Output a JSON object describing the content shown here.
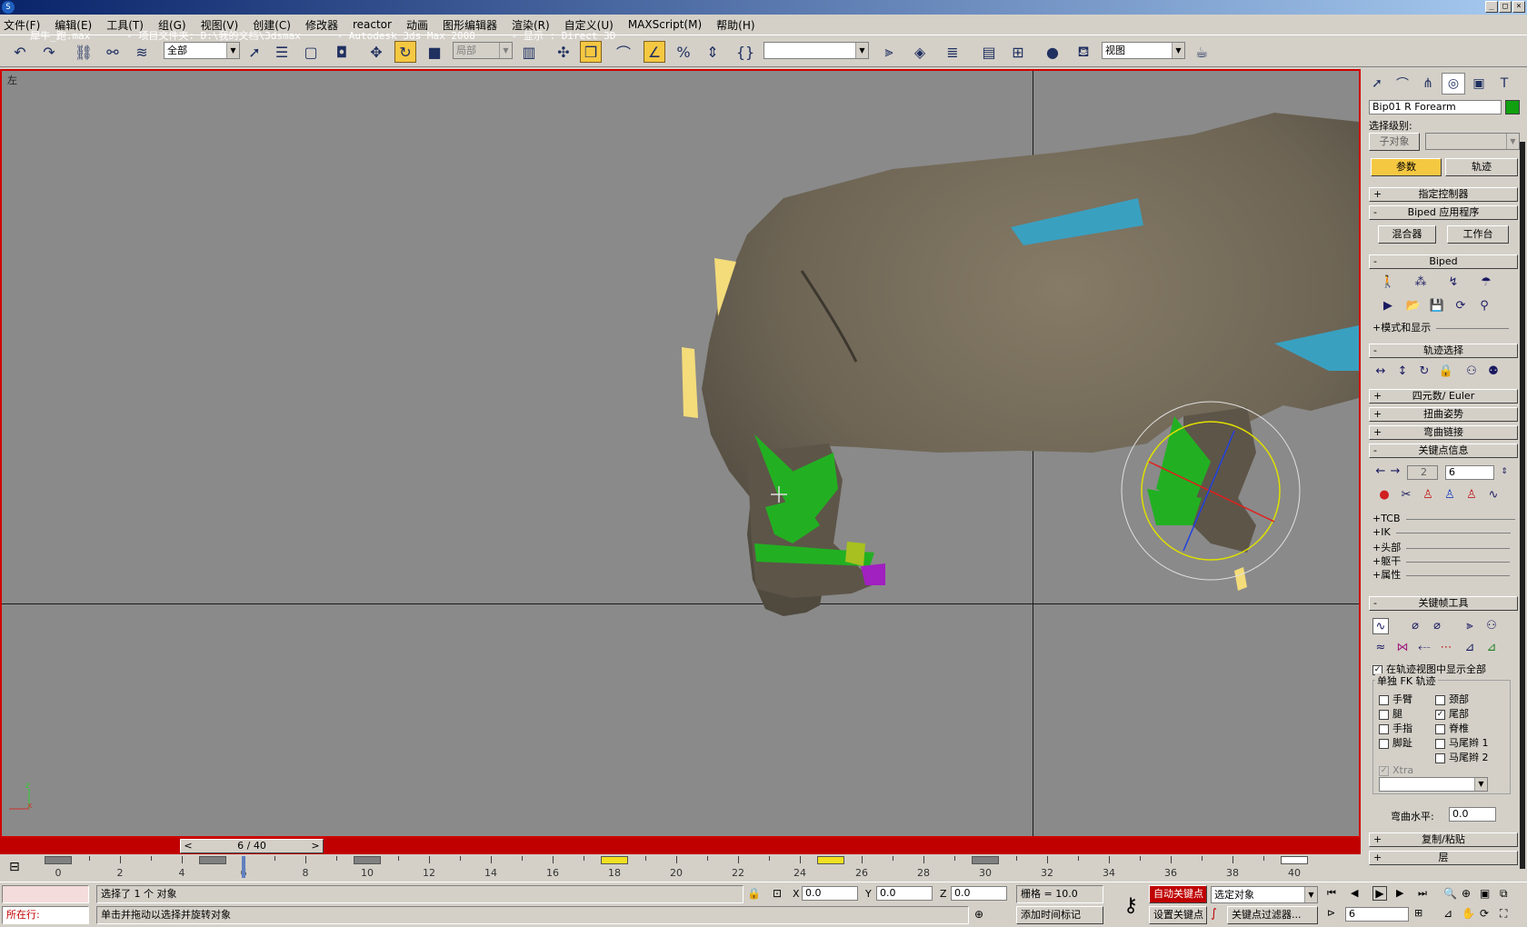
{
  "title": {
    "text": "犀牛_跑.max      - 项目文件夹: D:\\我的文档\\3dsmax      - Autodesk 3ds Max 2008      - 显示 : Direct 3D",
    "min": "_",
    "max": "□",
    "close": "×"
  },
  "menu": [
    "文件(F)",
    "编辑(E)",
    "工具(T)",
    "组(G)",
    "视图(V)",
    "创建(C)",
    "修改器",
    "reactor",
    "动画",
    "图形编辑器",
    "渲染(R)",
    "自定义(U)",
    "MAXScript(M)",
    "帮助(H)"
  ],
  "toolbar": {
    "selection_filter": "全部",
    "coord_system": "局部",
    "named_selection": "",
    "viewport_select": "视图"
  },
  "viewport": {
    "label": "左",
    "axis_z": "z",
    "axis_x": "x"
  },
  "timeline": {
    "frame": "6 / 40",
    "prev": "<",
    "next": ">",
    "ticks": [
      "0",
      "2",
      "4",
      "6",
      "8",
      "10",
      "12",
      "14",
      "16",
      "18",
      "20",
      "22",
      "24",
      "26",
      "28",
      "30",
      "32",
      "34",
      "36",
      "38",
      "40"
    ],
    "current_frame": 6,
    "total_frames": 40,
    "key_frames": [
      {
        "frame": 0,
        "color": "#808080"
      },
      {
        "frame": 5,
        "color": "#808080"
      },
      {
        "frame": 10,
        "color": "#808080"
      },
      {
        "frame": 18,
        "color": "#f0e020"
      },
      {
        "frame": 25,
        "color": "#f0e020"
      },
      {
        "frame": 30,
        "color": "#808080"
      },
      {
        "frame": 40,
        "color": "#ffffff"
      }
    ]
  },
  "status": {
    "maxscript_label": "所在行:",
    "selected": "选择了 1 个 对象",
    "prompt": "单击并拖动以选择并旋转对象",
    "x_label": "X",
    "x": "0.0",
    "y_label": "Y",
    "y": "0.0",
    "z_label": "Z",
    "z": "0.0",
    "grid": "栅格 = 10.0",
    "add_time_tag": "添加时间标记",
    "auto_key": "自动关键点",
    "set_key": "设置关键点",
    "key_mode": "选定对象",
    "key_filters": "关键点过滤器...",
    "current_frame_field": "6"
  },
  "command_panel": {
    "object_name": "Bip01 R Forearm",
    "object_color": "#10a010",
    "selection_level": "选择级别:",
    "sub_object": "子对象",
    "tab_params": "参数",
    "tab_trajectory": "轨迹",
    "rollups": {
      "assign_controller": "指定控制器",
      "biped_apps": "Biped 应用程序",
      "biped": "Biped",
      "track_select": "轨迹选择",
      "quaternion": "四元数/ Euler",
      "twist_pose": "扭曲姿势",
      "bend_links": "弯曲链接",
      "key_info": "关键点信息",
      "keyframe_tools": "关键帧工具",
      "copy_paste": "复制/粘贴",
      "layers": "层"
    },
    "mixer": "混合器",
    "workbench": "工作台",
    "mode_display": "模式和显示",
    "key_nav": {
      "left": "2",
      "right": "6"
    },
    "key_sub": [
      "TCB",
      "IK",
      "头部",
      "躯干",
      "属性"
    ],
    "show_all_label": "在轨迹视图中显示全部",
    "separate_fk": "单独 FK 轨迹",
    "fk_left": [
      {
        "label": "手臂",
        "checked": false
      },
      {
        "label": "腿",
        "checked": false
      },
      {
        "label": "手指",
        "checked": false
      },
      {
        "label": "脚趾",
        "checked": false
      }
    ],
    "fk_right": [
      {
        "label": "颈部",
        "checked": false
      },
      {
        "label": "尾部",
        "checked": true
      },
      {
        "label": "脊椎",
        "checked": false
      },
      {
        "label": "马尾辫 1",
        "checked": false
      },
      {
        "label": "马尾辫 2",
        "checked": false
      }
    ],
    "xtra": "Xtra",
    "bend_level_label": "弯曲水平:",
    "bend_level": "0.0"
  }
}
